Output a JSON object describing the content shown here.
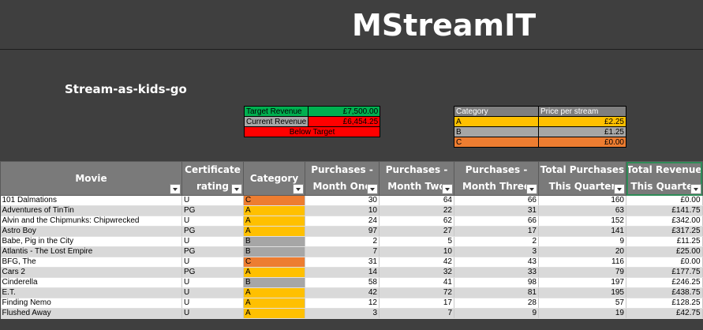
{
  "app_title": "MStreamIT",
  "subtitle": "Stream-as-kids-go",
  "kpi": {
    "target_label": "Target Revenue",
    "target_value": "£7,500.00",
    "current_label": "Current Revenue",
    "current_value": "£6,454.25",
    "status": "Below Target",
    "colors": {
      "target": "#00b050",
      "current": "#ff0000",
      "status": "#ff0000",
      "label": "#a6a6a6"
    }
  },
  "price_table": {
    "headers": [
      "Category",
      "Price per stream"
    ],
    "rows": [
      {
        "cat": "A",
        "price": "£2.25",
        "color": "#ffc000"
      },
      {
        "cat": "B",
        "price": "£1.25",
        "color": "#a6a6a6"
      },
      {
        "cat": "C",
        "price": "£0.00",
        "color": "#ed7d31"
      }
    ]
  },
  "columns": [
    {
      "l1": "Movie",
      "l2": ""
    },
    {
      "l1": "Certificate",
      "l2": "rating"
    },
    {
      "l1": "Category",
      "l2": ""
    },
    {
      "l1": "Purchases -",
      "l2": "Month One"
    },
    {
      "l1": "Purchases -",
      "l2": "Month Two"
    },
    {
      "l1": "Purchases -",
      "l2": "Month Three"
    },
    {
      "l1": "Total Purchases",
      "l2": "This Quarter"
    },
    {
      "l1": "Total Revenue",
      "l2": "This Quarter"
    }
  ],
  "category_colors": {
    "A": "#ffc000",
    "B": "#a6a6a6",
    "C": "#ed7d31"
  },
  "rows": [
    {
      "movie": "101 Dalmations",
      "cert": "U",
      "cat": "C",
      "m1": "30",
      "m2": "64",
      "m3": "66",
      "total": "160",
      "revenue": "£0.00"
    },
    {
      "movie": "Adventures of TinTin",
      "cert": "PG",
      "cat": "A",
      "m1": "10",
      "m2": "22",
      "m3": "31",
      "total": "63",
      "revenue": "£141.75"
    },
    {
      "movie": "Alvin and the Chipmunks: Chipwrecked",
      "cert": "U",
      "cat": "A",
      "m1": "24",
      "m2": "62",
      "m3": "66",
      "total": "152",
      "revenue": "£342.00"
    },
    {
      "movie": "Astro Boy",
      "cert": "PG",
      "cat": "A",
      "m1": "97",
      "m2": "27",
      "m3": "17",
      "total": "141",
      "revenue": "£317.25"
    },
    {
      "movie": "Babe, Pig in the City",
      "cert": "U",
      "cat": "B",
      "m1": "2",
      "m2": "5",
      "m3": "2",
      "total": "9",
      "revenue": "£11.25"
    },
    {
      "movie": "Atlantis - The Lost Empire",
      "cert": "PG",
      "cat": "B",
      "m1": "7",
      "m2": "10",
      "m3": "3",
      "total": "20",
      "revenue": "£25.00"
    },
    {
      "movie": "BFG, The",
      "cert": "U",
      "cat": "C",
      "m1": "31",
      "m2": "42",
      "m3": "43",
      "total": "116",
      "revenue": "£0.00"
    },
    {
      "movie": "Cars 2",
      "cert": "PG",
      "cat": "A",
      "m1": "14",
      "m2": "32",
      "m3": "33",
      "total": "79",
      "revenue": "£177.75"
    },
    {
      "movie": "Cinderella",
      "cert": "U",
      "cat": "B",
      "m1": "58",
      "m2": "41",
      "m3": "98",
      "total": "197",
      "revenue": "£246.25"
    },
    {
      "movie": "E.T.",
      "cert": "U",
      "cat": "A",
      "m1": "42",
      "m2": "72",
      "m3": "81",
      "total": "195",
      "revenue": "£438.75"
    },
    {
      "movie": "Finding Nemo",
      "cert": "U",
      "cat": "A",
      "m1": "12",
      "m2": "17",
      "m3": "28",
      "total": "57",
      "revenue": "£128.25"
    },
    {
      "movie": "Flushed Away",
      "cert": "U",
      "cat": "A",
      "m1": "3",
      "m2": "7",
      "m3": "9",
      "total": "19",
      "revenue": "£42.75"
    }
  ]
}
